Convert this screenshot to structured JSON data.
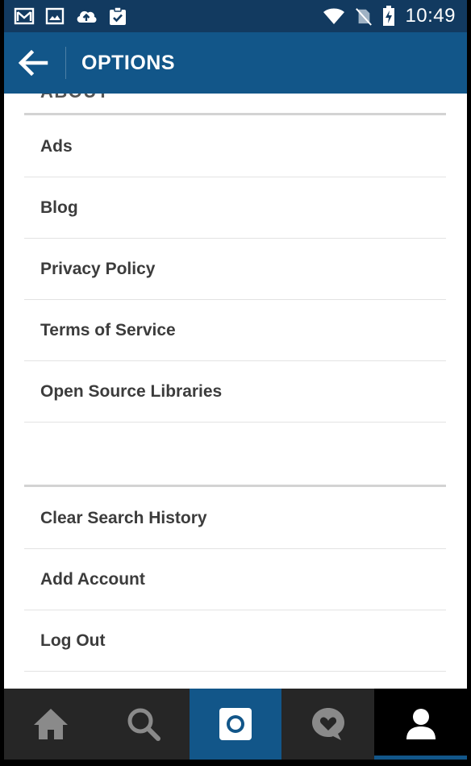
{
  "status_bar": {
    "time": "10:49",
    "icons": [
      "gmail-icon",
      "image-icon",
      "cloud-upload-icon",
      "clipboard-check-icon",
      "wifi-icon",
      "no-sim-icon",
      "battery-charging-icon"
    ]
  },
  "header": {
    "title": "OPTIONS"
  },
  "about_section": {
    "header_label": "ABOUT",
    "items": [
      {
        "label": "Ads"
      },
      {
        "label": "Blog"
      },
      {
        "label": "Privacy Policy"
      },
      {
        "label": "Terms of Service"
      },
      {
        "label": "Open Source Libraries"
      }
    ]
  },
  "account_section": {
    "items": [
      {
        "label": "Clear Search History"
      },
      {
        "label": "Add Account"
      },
      {
        "label": "Log Out"
      }
    ]
  },
  "bottom_nav": {
    "tabs": [
      {
        "icon": "home-icon",
        "active": false
      },
      {
        "icon": "search-icon",
        "active": false
      },
      {
        "icon": "camera-icon",
        "active": false
      },
      {
        "icon": "activity-heart-icon",
        "active": false
      },
      {
        "icon": "profile-icon",
        "active": true
      }
    ]
  },
  "colors": {
    "status_bar": "#123a60",
    "app_bar": "#125689",
    "nav_bar": "#262626",
    "accent": "#125689"
  }
}
